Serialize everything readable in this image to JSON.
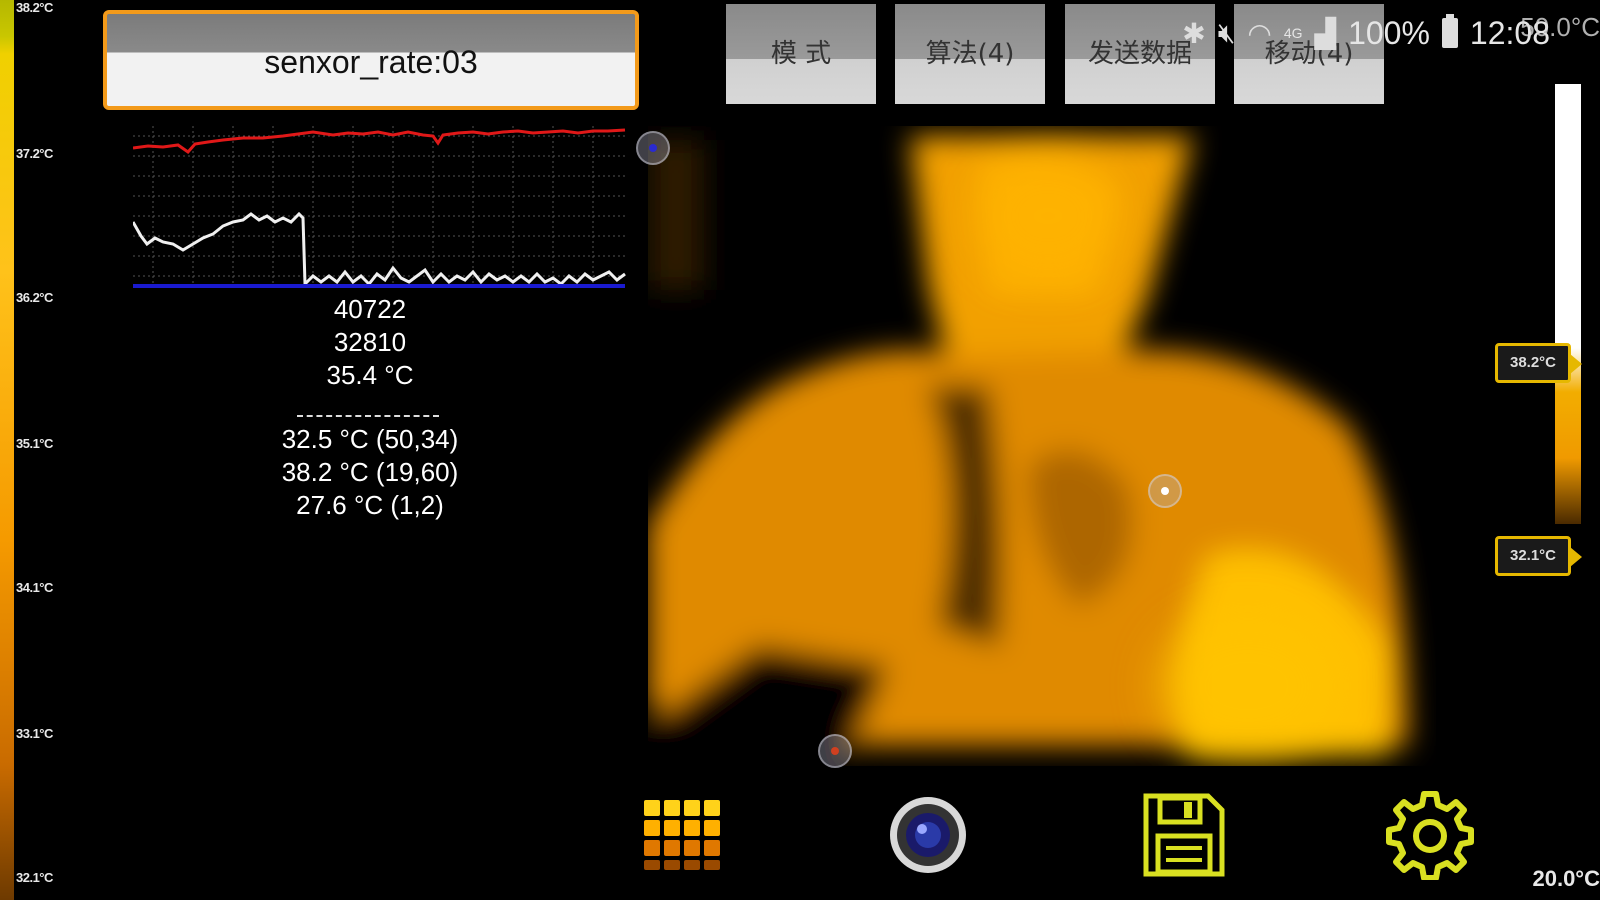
{
  "left_scale": {
    "labels": [
      "38.2°C",
      "37.2°C",
      "36.2°C",
      "35.1°C",
      "34.1°C",
      "33.1°C",
      "32.1°C"
    ]
  },
  "rate_box": {
    "text": "senxor_rate:03"
  },
  "readouts": {
    "line1": "40722",
    "line2": "32810",
    "line3": "35.4 °C",
    "max": "32.5 °C (50,34)",
    "spot": "38.2 °C (19,60)",
    "min": "27.6 °C (1,2)"
  },
  "top_buttons": [
    {
      "label": "模  式"
    },
    {
      "label": "算法(4)"
    },
    {
      "label": "发送数据"
    },
    {
      "label": "移动(4)"
    }
  ],
  "status_bar": {
    "network": "4G",
    "battery": "100%",
    "time": "12:08",
    "overlay_temp": "50.0°C"
  },
  "right_scale": {
    "max_tag": "38.2°C",
    "min_tag": "32.1°C",
    "bottom_label": "20.0°C"
  },
  "toolbar": [
    {
      "icon": "palette-grid-icon"
    },
    {
      "icon": "camera-icon"
    },
    {
      "icon": "save-icon"
    },
    {
      "icon": "gear-icon"
    }
  ],
  "colors": {
    "accent_orange": "#f39a1a",
    "icon_yellow": "#d9e021",
    "chart_red": "#e01818",
    "chart_blue": "#1a1ad0"
  }
}
